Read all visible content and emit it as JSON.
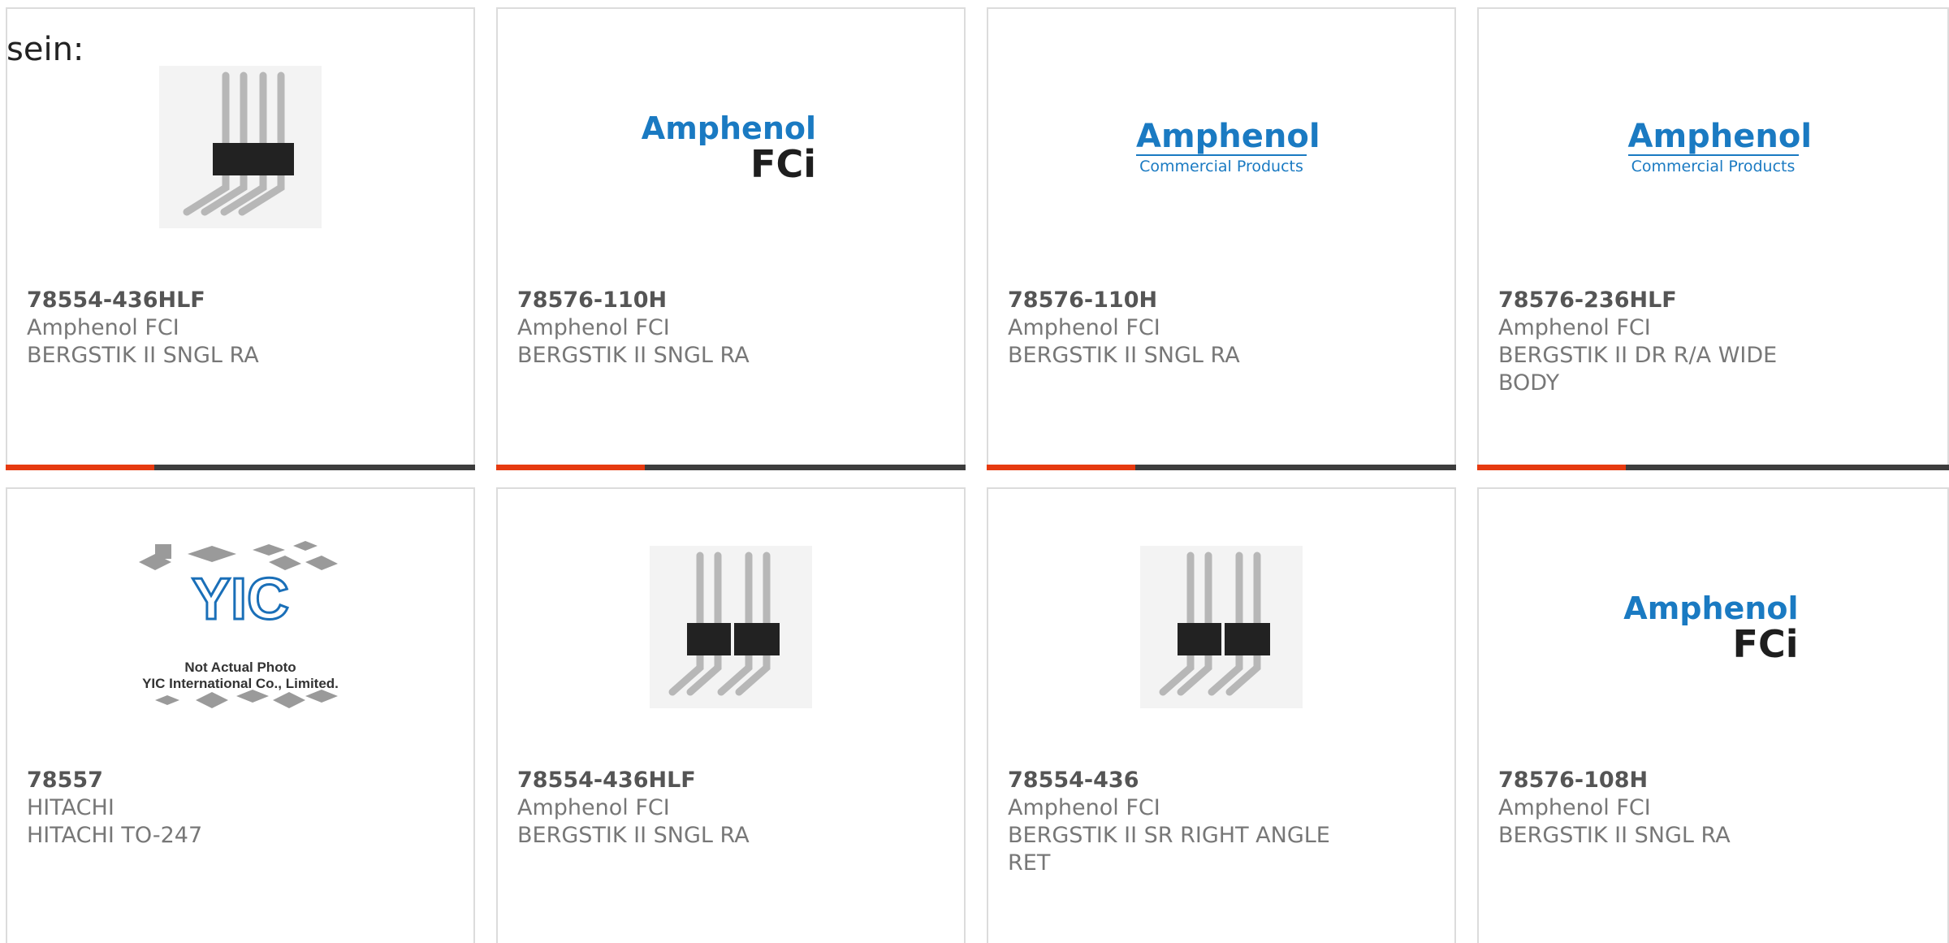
{
  "lead_text": "sein:",
  "colors": {
    "accent": "#e63a10",
    "bar": "#3d3d3d",
    "brand_blue": "#1a7ac2"
  },
  "cards": [
    {
      "part_number": "78554-436HLF",
      "manufacturer": "Amphenol FCI",
      "description": "BERGSTIK II SNGL RA",
      "image": "pin-header-icon"
    },
    {
      "part_number": "78576-110H",
      "manufacturer": "Amphenol FCI",
      "description": "BERGSTIK II SNGL RA",
      "image": "amphenol-fci-logo",
      "logo": {
        "line1": "Amphenol",
        "line2": "FCi"
      }
    },
    {
      "part_number": "78576-110H",
      "manufacturer": "Amphenol FCI",
      "description": "BERGSTIK II SNGL RA",
      "image": "amphenol-commercial-logo",
      "logo": {
        "line1": "Amphenol",
        "line2": "Commercial Products"
      }
    },
    {
      "part_number": "78576-236HLF",
      "manufacturer": "Amphenol FCI",
      "description": "BERGSTIK II DR R/A WIDE BODY",
      "image": "amphenol-commercial-logo",
      "logo": {
        "line1": "Amphenol",
        "line2": "Commercial Products"
      }
    },
    {
      "part_number": "78557",
      "manufacturer": "HITACHI",
      "description": "HITACHI TO-247",
      "image": "not-actual-photo-icon",
      "placeholder": {
        "line1": "Not Actual Photo",
        "line2": "YIC International Co., Limited."
      }
    },
    {
      "part_number": "78554-436HLF",
      "manufacturer": "Amphenol FCI",
      "description": "BERGSTIK II SNGL RA",
      "image": "pin-header-icon"
    },
    {
      "part_number": "78554-436",
      "manufacturer": "Amphenol FCI",
      "description": "BERGSTIK II SR RIGHT ANGLE RET",
      "image": "pin-header-icon"
    },
    {
      "part_number": "78576-108H",
      "manufacturer": "Amphenol FCI",
      "description": "BERGSTIK II SNGL RA",
      "image": "amphenol-fci-logo",
      "logo": {
        "line1": "Amphenol",
        "line2": "FCi"
      }
    }
  ]
}
